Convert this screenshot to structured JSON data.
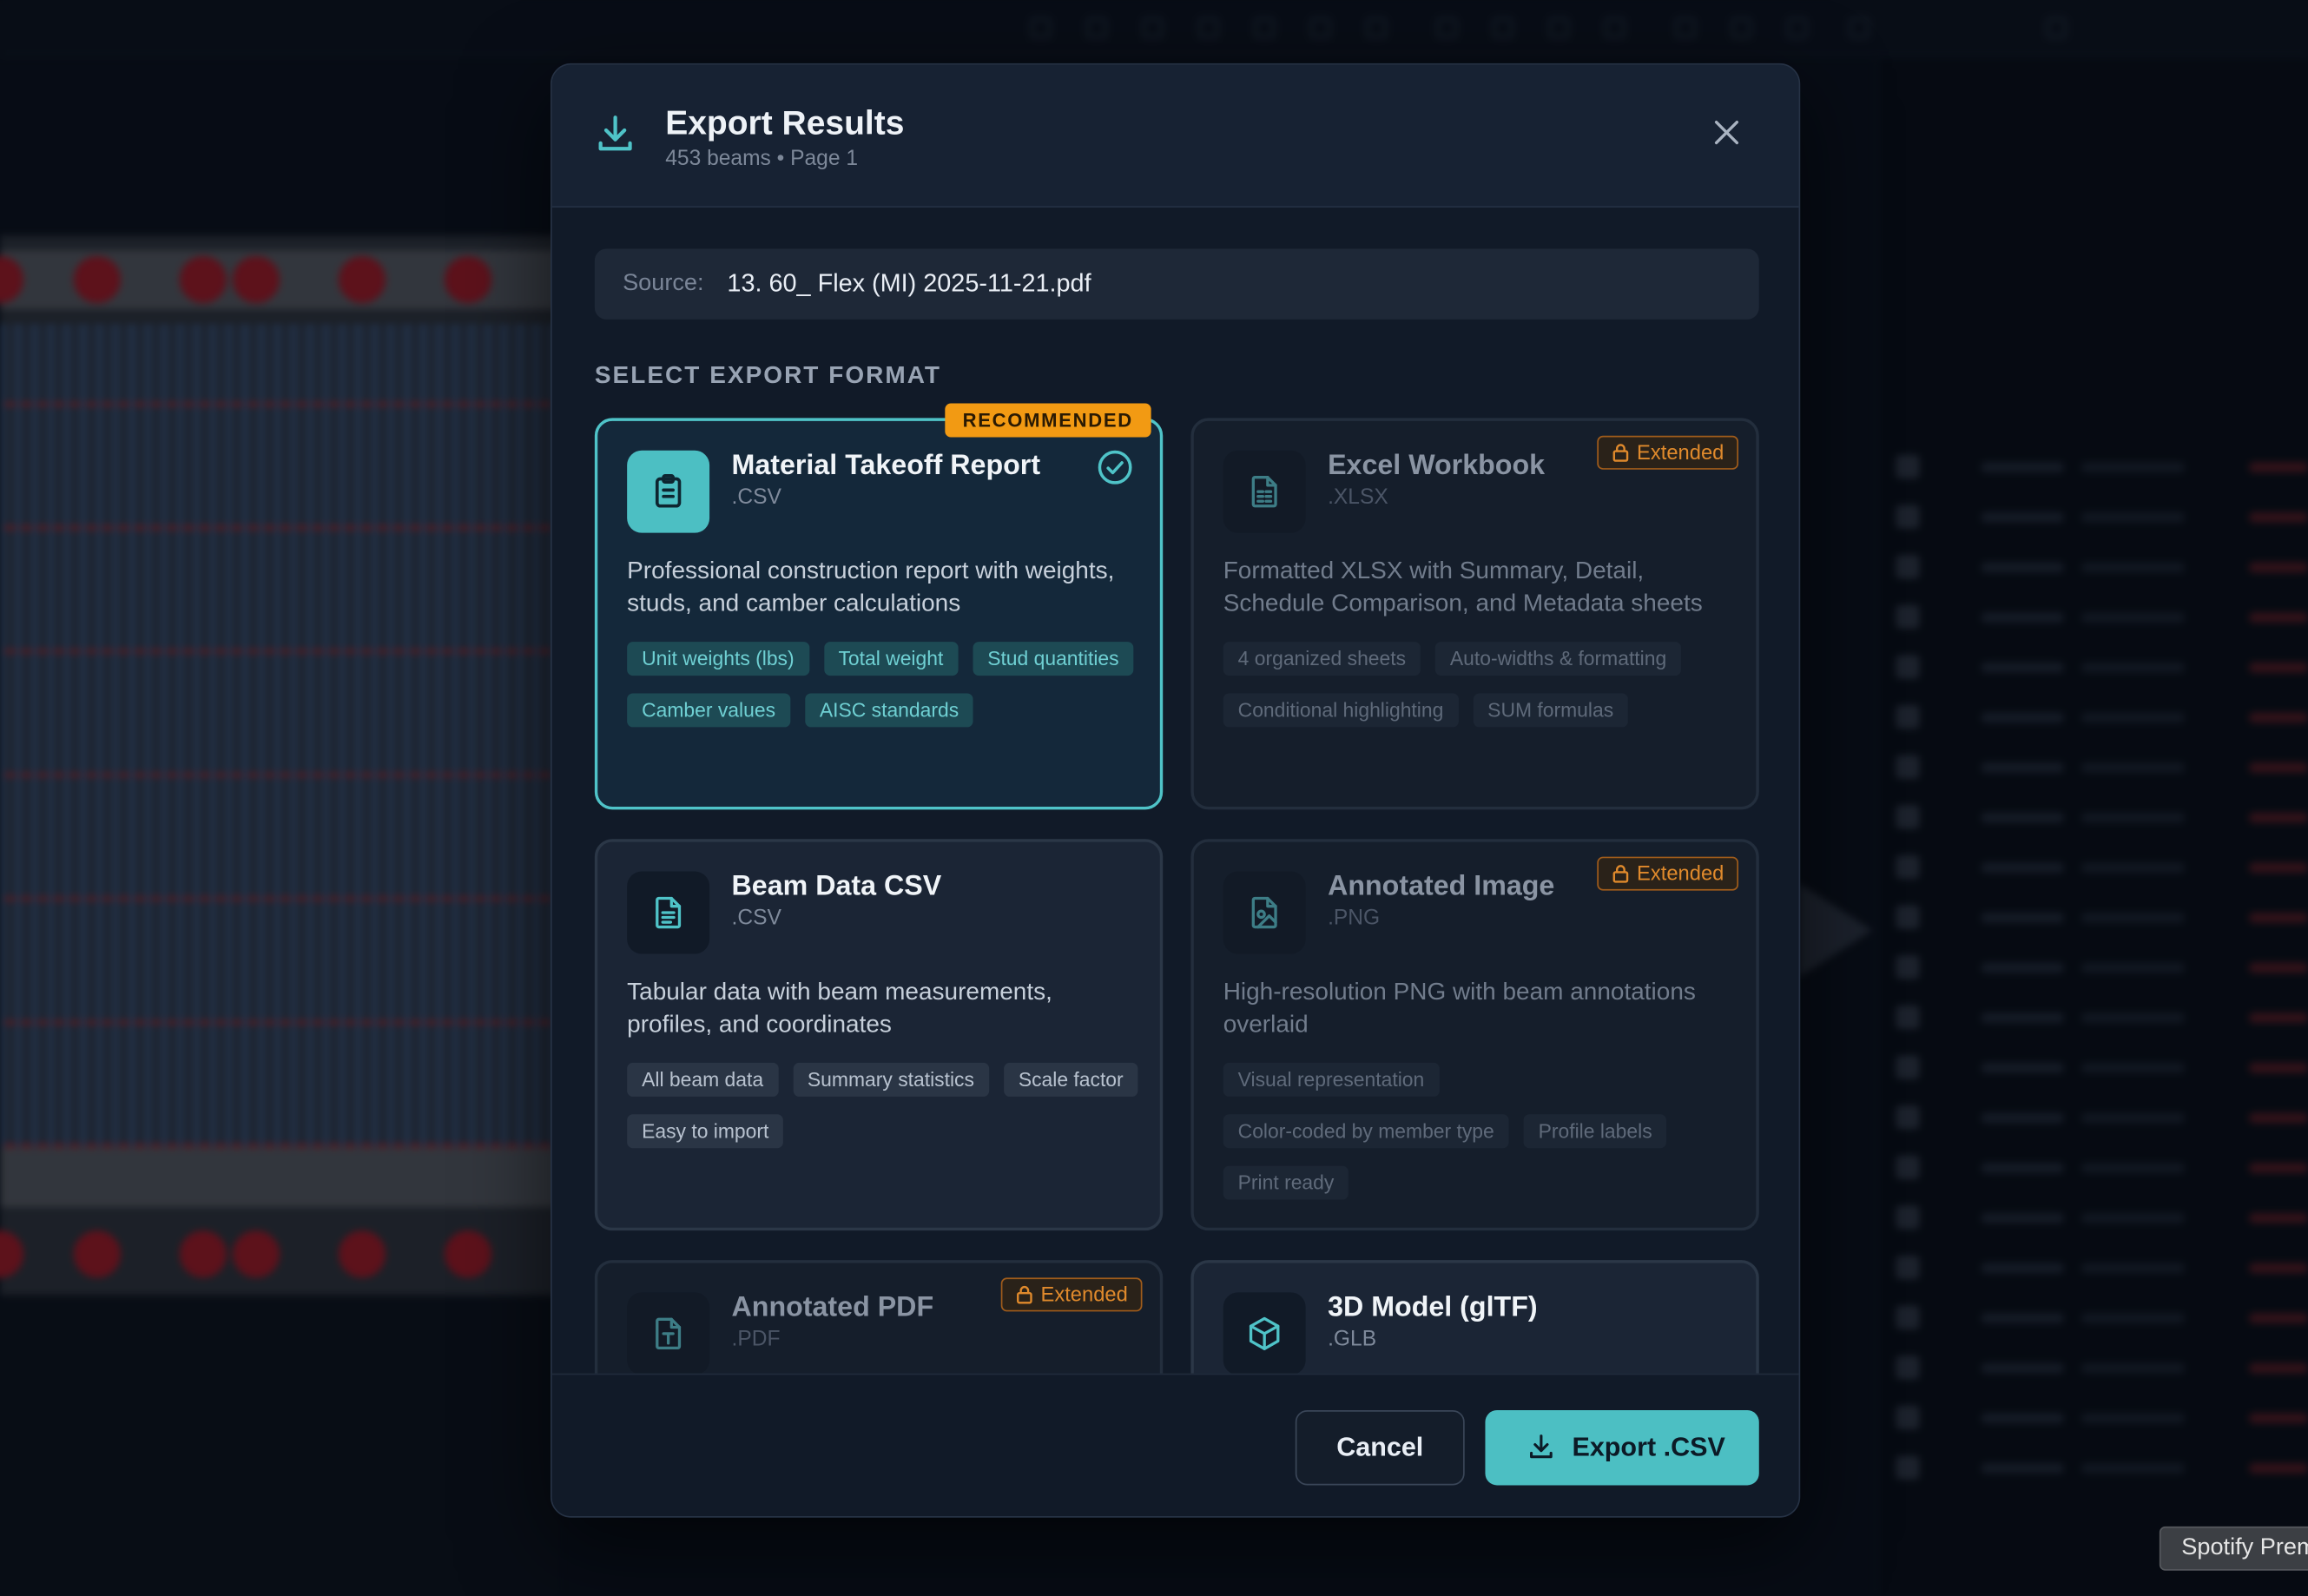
{
  "modal": {
    "title": "Export Results",
    "subtitle": "453 beams • Page 1",
    "source_label": "Source:",
    "source_value": "13. 60_ Flex (MI) 2025-11-21.pdf",
    "section_title": "SELECT EXPORT FORMAT",
    "formats": [
      {
        "name": "Material Takeoff Report",
        "ext": ".CSV",
        "icon": "clipboard-icon",
        "badge": "RECOMMENDED",
        "selected": true,
        "description": "Professional construction report with weights, studs, and camber calculations",
        "tags": [
          "Unit weights (lbs)",
          "Total weight",
          "Stud quantities",
          "Camber values",
          "AISC standards"
        ]
      },
      {
        "name": "Excel Workbook",
        "ext": ".XLSX",
        "icon": "spreadsheet-icon",
        "badge": "Extended",
        "locked": true,
        "description": "Formatted XLSX with Summary, Detail, Schedule Comparison, and Metadata sheets",
        "tags": [
          "4 organized sheets",
          "Auto-widths & formatting",
          "Conditional highlighting",
          "SUM formulas"
        ]
      },
      {
        "name": "Beam Data CSV",
        "ext": ".CSV",
        "icon": "document-icon",
        "description": "Tabular data with beam measurements, profiles, and coordinates",
        "tags": [
          "All beam data",
          "Summary statistics",
          "Scale factor",
          "Easy to import"
        ]
      },
      {
        "name": "Annotated Image",
        "ext": ".PNG",
        "icon": "image-file-icon",
        "badge": "Extended",
        "locked": true,
        "description": "High-resolution PNG with beam annotations overlaid",
        "tags": [
          "Visual representation",
          "Color-coded by member type",
          "Profile labels",
          "Print ready"
        ]
      },
      {
        "name": "Annotated PDF",
        "ext": ".PDF",
        "icon": "pdf-file-icon",
        "badge": "Extended",
        "locked": true
      },
      {
        "name": "3D Model (glTF)",
        "ext": ".GLB",
        "icon": "cube-icon"
      }
    ],
    "cancel_label": "Cancel",
    "export_label": "Export .CSV"
  },
  "tooltip": "Spotify Premium",
  "colors": {
    "accent": "#4cbfc3",
    "recommended": "#f29a13",
    "extended": "#e08a2c",
    "modal_bg": "#111a28"
  }
}
